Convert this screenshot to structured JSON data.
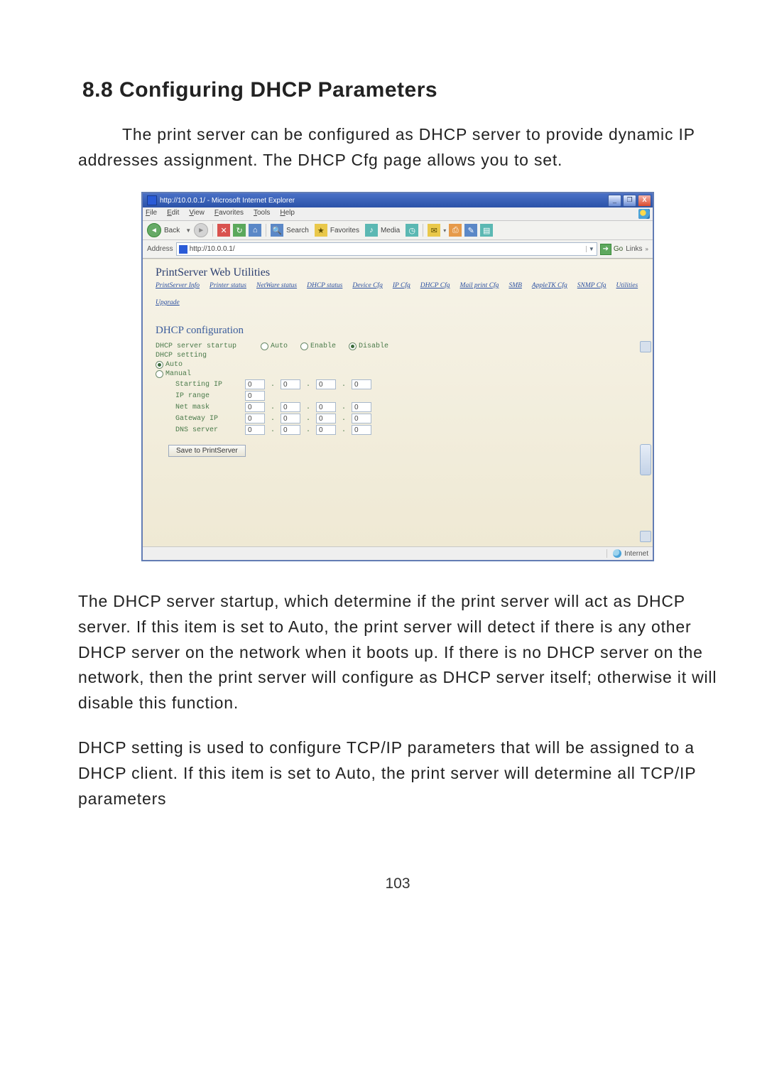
{
  "section_title": "8.8    Configuring DHCP Parameters",
  "intro_para": "The print server can be configured as DHCP server to provide dynamic IP addresses assignment. The DHCP Cfg page allows you to set.",
  "para2": "The DHCP server startup, which determine if the print server will act as DHCP server. If this item is set to Auto, the print server will detect if there is any other DHCP server on the network when it boots up. If there is no DHCP server on the network, then the print server will configure as DHCP server itself; otherwise it will disable this function.",
  "para3": "DHCP setting is used to configure TCP/IP parameters that will be assigned to a DHCP client. If this item is set to Auto, the print server will determine all TCP/IP parameters",
  "page_number": "103",
  "browser": {
    "titlebar": {
      "title": "http://10.0.0.1/ - Microsoft Internet Explorer",
      "min": "_",
      "max": "❐",
      "close": "X"
    },
    "menu": [
      "File",
      "Edit",
      "View",
      "Favorites",
      "Tools",
      "Help"
    ],
    "toolbar": {
      "back": "Back",
      "search": "Search",
      "favorites": "Favorites",
      "media": "Media"
    },
    "addressbar": {
      "label": "Address",
      "url": "http://10.0.0.1/",
      "go": "Go",
      "links": "Links"
    },
    "content": {
      "app_title": "PrintServer  Web Utilities",
      "nav": [
        "PrintServer Info",
        "Printer status",
        "NetWare status",
        "DHCP status",
        "Device Cfg",
        "IP Cfg",
        "DHCP Cfg",
        "Mail print Cfg",
        "SMB",
        "AppleTK Cfg",
        "SNMP Cfg",
        "Utilities",
        "Upgrade"
      ],
      "section_head": "DHCP configuration",
      "form": {
        "startup_label": "DHCP server startup",
        "startup_options": [
          "Auto",
          "Enable",
          "Disable"
        ],
        "startup_selected": "Disable",
        "setting_label": "DHCP setting",
        "setting_options": [
          "Auto",
          "Manual"
        ],
        "setting_selected": "Auto",
        "rows": {
          "starting_ip": {
            "label": "Starting IP",
            "octets": [
              "0",
              "0",
              "0",
              "0"
            ]
          },
          "ip_range": {
            "label": "IP range",
            "value": "0"
          },
          "net_mask": {
            "label": "Net mask",
            "octets": [
              "0",
              "0",
              "0",
              "0"
            ]
          },
          "gateway_ip": {
            "label": "Gateway IP",
            "octets": [
              "0",
              "0",
              "0",
              "0"
            ]
          },
          "dns_server": {
            "label": "DNS server",
            "octets": [
              "0",
              "0",
              "0",
              "0"
            ]
          }
        },
        "save_label": "Save to PrintServer"
      }
    },
    "statusbar": {
      "ready": "",
      "zone": "Internet"
    }
  }
}
